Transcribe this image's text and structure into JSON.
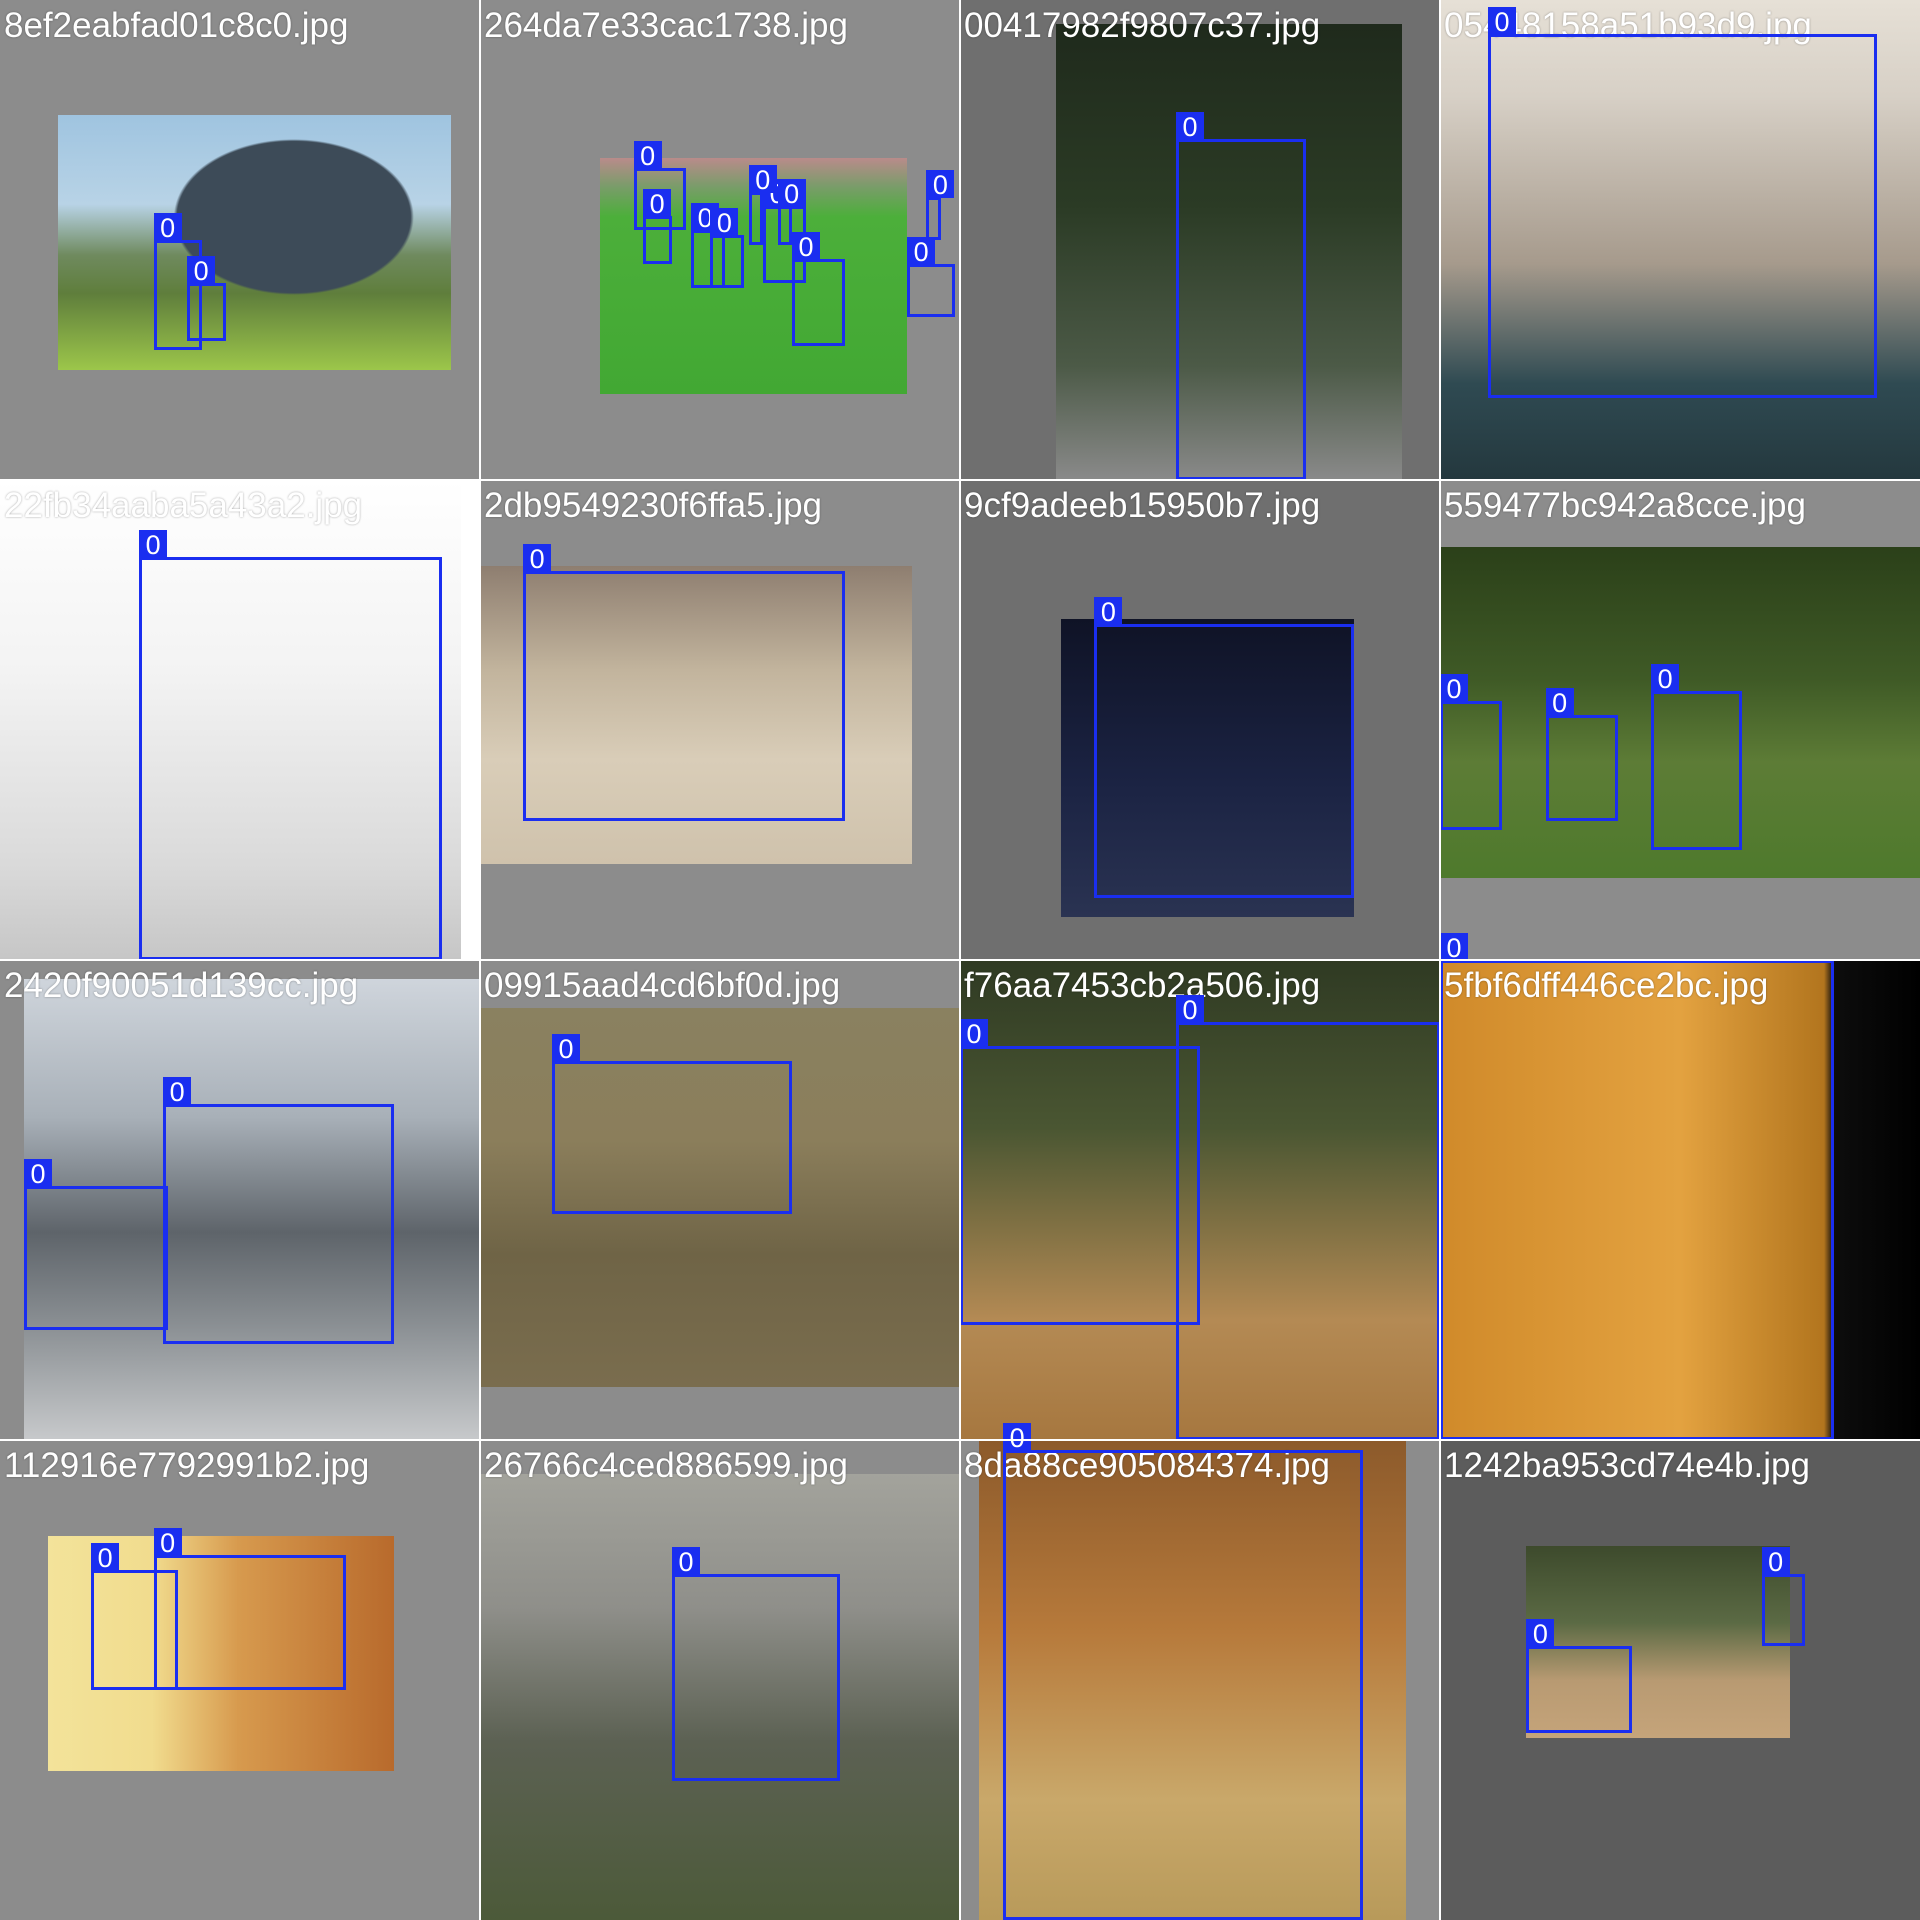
{
  "grid": {
    "columns": 4,
    "rows": 4
  },
  "colors": {
    "box": "#1a2ef0",
    "label_text": "#ffffff",
    "letterbox": "#8c8c8c"
  },
  "tiles": [
    {
      "filename": "8ef2eabfad01c8c0.jpg",
      "scene": {
        "bg": "#8c8c8c",
        "photo": [
          0.12,
          0.24,
          0.94,
          0.77
        ],
        "layers": [
          [
            "linear-gradient(180deg,#9fc4e0 0%,#b8d3e6 35%,#6f8a5e 55%,#5f7e3c 70%,#9cc64a 100%)"
          ],
          [
            "radial-gradient(ellipse at 60% 40%,#3d4b58 0%,#3d4b58 35%,transparent 36%)"
          ]
        ]
      },
      "boxes": [
        {
          "cls": "0",
          "b": [
            0.32,
            0.5,
            0.42,
            0.73
          ]
        },
        {
          "cls": "0",
          "b": [
            0.39,
            0.59,
            0.47,
            0.71
          ]
        }
      ]
    },
    {
      "filename": "264da7e33cac1738.jpg",
      "scene": {
        "bg": "#8c8c8c",
        "photo": [
          0.25,
          0.33,
          0.89,
          0.82
        ],
        "layers": [
          [
            "linear-gradient(180deg,#b98b8b 0%,#7a9c6a 12%,#4caf3a 25%,#42a833 100%)"
          ]
        ]
      },
      "boxes": [
        {
          "cls": "0",
          "b": [
            0.32,
            0.35,
            0.43,
            0.48
          ]
        },
        {
          "cls": "0",
          "b": [
            0.34,
            0.45,
            0.4,
            0.55
          ]
        },
        {
          "cls": "0",
          "b": [
            0.44,
            0.48,
            0.51,
            0.6
          ]
        },
        {
          "cls": "0",
          "b": [
            0.48,
            0.49,
            0.55,
            0.6
          ]
        },
        {
          "cls": "0",
          "b": [
            0.59,
            0.43,
            0.68,
            0.59
          ]
        },
        {
          "cls": "0",
          "b": [
            0.65,
            0.54,
            0.76,
            0.72
          ]
        },
        {
          "cls": "0",
          "b": [
            0.89,
            0.55,
            0.99,
            0.66
          ]
        },
        {
          "cls": "0",
          "b": [
            0.93,
            0.41,
            0.96,
            0.5
          ]
        },
        {
          "cls": "0",
          "b": [
            0.56,
            0.4,
            0.59,
            0.51
          ]
        },
        {
          "cls": "0",
          "b": [
            0.62,
            0.43,
            0.65,
            0.51
          ]
        }
      ]
    },
    {
      "filename": "00417982f9807c37.jpg",
      "scene": {
        "bg": "#6f6f6f",
        "photo": [
          0.2,
          0.05,
          0.92,
          1.0
        ],
        "layers": [
          [
            "linear-gradient(180deg,#1f2a1c 0%,#2b3b25 40%,#4c5a47 75%,#8a8a8a 100%)"
          ]
        ]
      },
      "boxes": [
        {
          "cls": "0",
          "b": [
            0.45,
            0.29,
            0.72,
            1.0
          ]
        }
      ]
    },
    {
      "filename": "05448158a51b93d9.jpg",
      "scene": {
        "bg": "#8c8c8c",
        "photo": [
          0.0,
          0.0,
          1.0,
          1.0
        ],
        "layers": [
          [
            "linear-gradient(180deg,#e6e0d6 0%,#d7d0c6 20%,#a69a8c 55%,#2f4a52 80%,#24383e 100%)"
          ]
        ]
      },
      "boxes": [
        {
          "cls": "0",
          "b": [
            0.1,
            0.07,
            0.91,
            0.83
          ]
        }
      ]
    },
    {
      "filename": "22fb34aaba5a43a2.jpg",
      "scene": {
        "bg": "#ffffff",
        "photo": [
          0.0,
          0.0,
          0.96,
          1.0
        ],
        "layers": [
          [
            "linear-gradient(180deg,#ffffff 0%,#f3f3f3 40%,#dadada 80%,#c6c6c6 100%)"
          ]
        ]
      },
      "boxes": [
        {
          "cls": "0",
          "b": [
            0.29,
            0.16,
            0.92,
            1.0
          ]
        }
      ]
    },
    {
      "filename": "2db9549230f6ffa5.jpg",
      "scene": {
        "bg": "#8c8c8c",
        "photo": [
          0.0,
          0.18,
          0.9,
          0.8
        ],
        "layers": [
          [
            "linear-gradient(180deg,#8e7e70 0%,#c2b49d 35%,#d9cdb8 65%,#cfc2ac 100%)"
          ]
        ]
      },
      "boxes": [
        {
          "cls": "0",
          "b": [
            0.09,
            0.19,
            0.76,
            0.71
          ]
        }
      ]
    },
    {
      "filename": "9cf9adeeb15950b7.jpg",
      "scene": {
        "bg": "#6f6f6f",
        "photo": [
          0.21,
          0.29,
          0.82,
          0.91
        ],
        "layers": [
          [
            "linear-gradient(180deg,#0f1326 0%,#1b2343 55%,#2a3352 100%)"
          ]
        ]
      },
      "boxes": [
        {
          "cls": "0",
          "b": [
            0.28,
            0.3,
            0.82,
            0.87
          ]
        }
      ]
    },
    {
      "filename": "559477bc942a8cce.jpg",
      "scene": {
        "bg": "#8c8c8c",
        "photo": [
          0.0,
          0.14,
          1.0,
          0.83
        ],
        "layers": [
          [
            "linear-gradient(180deg,#2b4019 0%,#3f5a26 40%,#5d7c36 65%,#4e7a2c 100%)"
          ]
        ]
      },
      "boxes": [
        {
          "cls": "0",
          "b": [
            0.0,
            0.46,
            0.13,
            0.73
          ]
        },
        {
          "cls": "0",
          "b": [
            0.22,
            0.49,
            0.37,
            0.71
          ]
        },
        {
          "cls": "0",
          "b": [
            0.44,
            0.44,
            0.63,
            0.77
          ]
        }
      ]
    },
    {
      "filename": "2420f90051d139cc.jpg",
      "scene": {
        "bg": "#8c8c8c",
        "photo": [
          0.05,
          0.04,
          1.0,
          1.0
        ],
        "layers": [
          [
            "linear-gradient(180deg,#cfd5dc 0%,#a8b0b8 30%,#5e646a 55%,#8a8f93 75%,#c7c9cb 100%)"
          ]
        ]
      },
      "boxes": [
        {
          "cls": "0",
          "b": [
            0.05,
            0.47,
            0.35,
            0.77
          ]
        },
        {
          "cls": "0",
          "b": [
            0.34,
            0.3,
            0.82,
            0.8
          ]
        }
      ]
    },
    {
      "filename": "09915aad4cd6bf0d.jpg",
      "scene": {
        "bg": "#8c8c8c",
        "photo": [
          0.0,
          0.1,
          1.0,
          0.89
        ],
        "layers": [
          [
            "linear-gradient(180deg,#8a8160 0%,#8b7e5b 35%,#6f6446 65%,#7a6d4e 100%)"
          ]
        ]
      },
      "boxes": [
        {
          "cls": "0",
          "b": [
            0.15,
            0.21,
            0.65,
            0.53
          ]
        }
      ]
    },
    {
      "filename": "f76aa7453cb2a506.jpg",
      "scene": {
        "bg": "#8c8c8c",
        "photo": [
          0.0,
          0.0,
          1.0,
          1.0
        ],
        "layers": [
          [
            "linear-gradient(180deg,#2f3a23 0%,#4a5632 35%,#b48a54 75%,#a6773f 100%)"
          ]
        ]
      },
      "boxes": [
        {
          "cls": "0",
          "b": [
            0.0,
            0.18,
            0.5,
            0.76
          ]
        },
        {
          "cls": "0",
          "b": [
            0.45,
            0.13,
            1.0,
            1.0
          ]
        }
      ]
    },
    {
      "filename": "5fbf6dff446ce2bc.jpg",
      "scene": {
        "bg": "#101010",
        "photo": [
          0.0,
          0.0,
          1.0,
          1.0
        ],
        "layers": [
          [
            "linear-gradient(90deg,#d08a2a 0%,#e3a240 50%,#b2751e 80%,#0d0d0d 82%,#000000 100%)"
          ]
        ]
      },
      "boxes": [
        {
          "cls": "0",
          "b": [
            0.0,
            0.0,
            0.82,
            1.0
          ]
        }
      ]
    },
    {
      "filename": "112916e7792991b2.jpg",
      "scene": {
        "bg": "#8c8c8c",
        "photo": [
          0.1,
          0.2,
          0.82,
          0.69
        ],
        "layers": [
          [
            "linear-gradient(90deg,#f3e39a 0%,#f1dc8e 30%,#d79a4e 55%,#b86a2c 100%)"
          ]
        ]
      },
      "boxes": [
        {
          "cls": "0",
          "b": [
            0.19,
            0.27,
            0.37,
            0.52
          ]
        },
        {
          "cls": "0",
          "b": [
            0.32,
            0.24,
            0.72,
            0.52
          ]
        }
      ]
    },
    {
      "filename": "26766c4ced886599.jpg",
      "scene": {
        "bg": "#8c8c8c",
        "photo": [
          0.0,
          0.07,
          1.0,
          1.0
        ],
        "layers": [
          [
            "linear-gradient(180deg,#a3a39c 0%,#8f8f8a 30%,#5c6153 60%,#4c5a39 100%)"
          ]
        ]
      },
      "boxes": [
        {
          "cls": "0",
          "b": [
            0.4,
            0.28,
            0.75,
            0.71
          ]
        }
      ]
    },
    {
      "filename": "8da88ce905084374.jpg",
      "scene": {
        "bg": "#8c8c8c",
        "photo": [
          0.04,
          0.0,
          0.93,
          1.0
        ],
        "layers": [
          [
            "linear-gradient(180deg,#8c5a2b 0%,#b77a3b 40%,#c9a86a 75%,#b89a5a 100%)"
          ]
        ]
      },
      "boxes": [
        {
          "cls": "0",
          "b": [
            0.09,
            0.02,
            0.84,
            1.0
          ]
        }
      ]
    },
    {
      "filename": "1242ba953cd74e4b.jpg",
      "scene": {
        "bg": "#5c5c5c",
        "photo": [
          0.18,
          0.22,
          0.73,
          0.62
        ],
        "layers": [
          [
            "linear-gradient(180deg,#3d4a2c 0%,#5b6a44 40%,#b89a72 70%,#c5a47a 100%)"
          ]
        ]
      },
      "boxes": [
        {
          "cls": "0",
          "b": [
            0.18,
            0.43,
            0.4,
            0.61
          ]
        },
        {
          "cls": "0",
          "b": [
            0.67,
            0.28,
            0.76,
            0.43
          ]
        }
      ]
    }
  ]
}
